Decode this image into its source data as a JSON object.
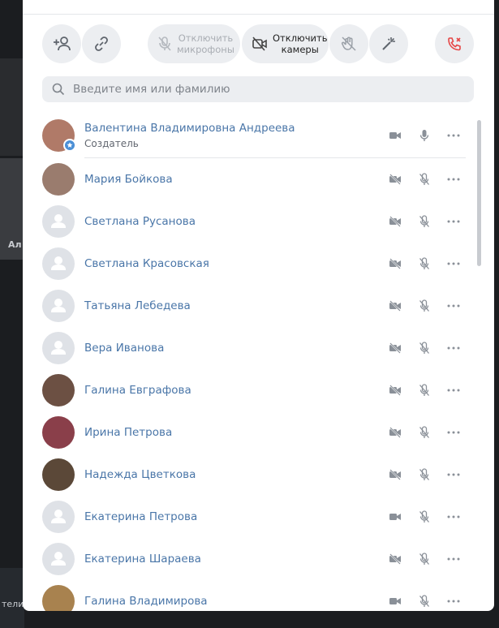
{
  "background": {
    "text_1": "Ал",
    "text_2": "тели"
  },
  "controls": {
    "add_user_icon": "add-user",
    "link_icon": "link",
    "mute_mics_label": "Отключить микрофоны",
    "disable_cams_label": "Отключить камеры",
    "raise_hand_icon": "hand",
    "effects_icon": "wand",
    "leave_icon": "phone-leave"
  },
  "search": {
    "placeholder": "Введите имя или фамилию"
  },
  "colors": {
    "link": "#4a76a8",
    "leave": "#e64646",
    "button_bg": "#eceef1"
  },
  "participants": [
    {
      "name": "Валентина Владимировна Андреева",
      "role": "Создатель",
      "avatar": "photo",
      "camera": "on",
      "mic": "on"
    },
    {
      "name": "Мария Бойкова",
      "avatar": "photo",
      "camera": "off",
      "mic": "off"
    },
    {
      "name": "Светлана Русанова",
      "avatar": "default",
      "camera": "off",
      "mic": "off"
    },
    {
      "name": "Светлана Красовская",
      "avatar": "default",
      "camera": "off",
      "mic": "off"
    },
    {
      "name": "Татьяна Лебедева",
      "avatar": "default",
      "camera": "off",
      "mic": "off"
    },
    {
      "name": "Вера Иванова",
      "avatar": "default",
      "camera": "off",
      "mic": "off"
    },
    {
      "name": "Галина Евграфова",
      "avatar": "photo",
      "camera": "off",
      "mic": "off"
    },
    {
      "name": "Ирина Петрова",
      "avatar": "photo",
      "camera": "off",
      "mic": "off"
    },
    {
      "name": "Надежда Цветкова",
      "avatar": "photo",
      "camera": "off",
      "mic": "off"
    },
    {
      "name": "Екатерина Петрова",
      "avatar": "default",
      "camera": "on",
      "mic": "off"
    },
    {
      "name": "Екатерина Шараева",
      "avatar": "default",
      "camera": "off",
      "mic": "off"
    },
    {
      "name": "Галина Владимирова",
      "avatar": "photo",
      "camera": "on",
      "mic": "off"
    }
  ]
}
